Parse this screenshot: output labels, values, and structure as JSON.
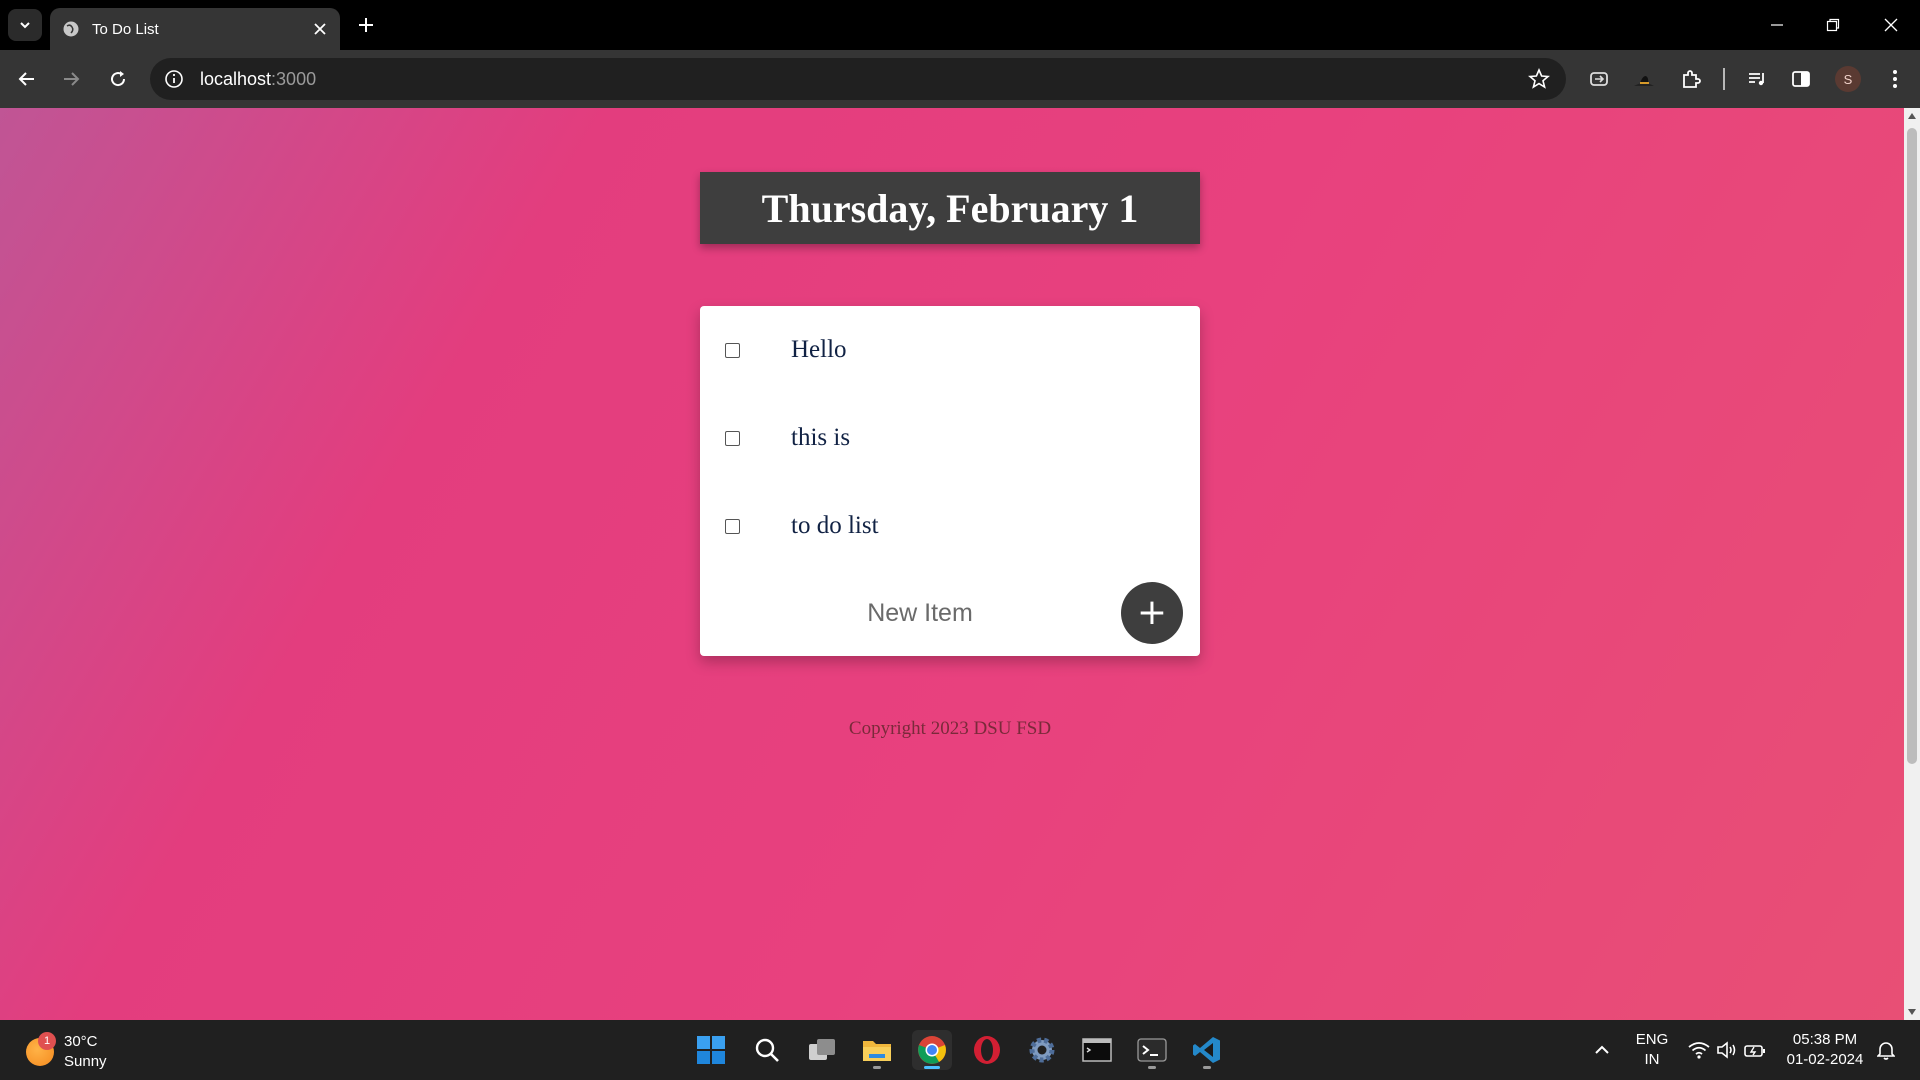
{
  "browser": {
    "tab_title": "To Do List",
    "url_host": "localhost",
    "url_port": ":3000",
    "profile_initial": "S"
  },
  "page": {
    "heading": "Thursday, February 1",
    "items": [
      {
        "label": "Hello",
        "checked": false
      },
      {
        "label": "this is",
        "checked": false
      },
      {
        "label": "to do list",
        "checked": false
      }
    ],
    "new_item_placeholder": "New Item",
    "add_button_label": "+",
    "footer": "Copyright 2023 DSU FSD"
  },
  "taskbar": {
    "weather_badge": "1",
    "temperature": "30°C",
    "condition": "Sunny",
    "language": "ENG",
    "region": "IN",
    "time": "05:38 PM",
    "date": "01-02-2024"
  },
  "colors": {
    "gradient_start": "#c05595",
    "gradient_end": "#e84f75",
    "heading_bg": "#3e3e3e",
    "item_text": "#112244"
  }
}
